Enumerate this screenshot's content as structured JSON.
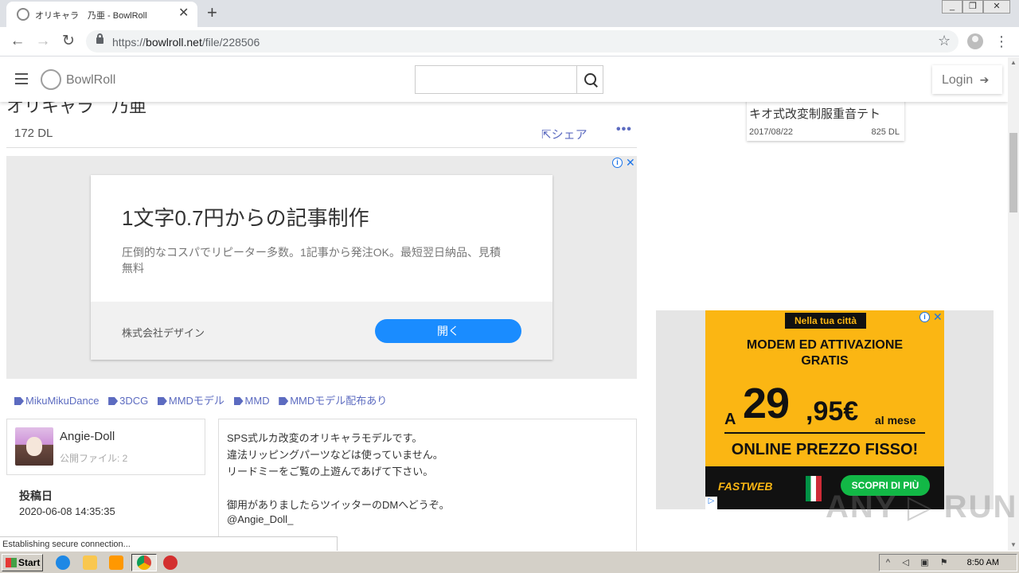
{
  "browser": {
    "tab_title": "オリキャラ　乃亜 - BowlRoll",
    "tab_close": "✕",
    "new_tab": "+",
    "url_scheme": "https://",
    "url_host": "bowlroll.net",
    "url_path": "/file/228506",
    "window_buttons": [
      "_",
      "❐",
      "✕"
    ]
  },
  "site": {
    "logo_text": "BowlRoll",
    "search": {
      "value": "",
      "placeholder": ""
    },
    "login_label": "Login"
  },
  "file": {
    "title_clipped": "オリキャラ　乃亜",
    "downloads": "172 DL",
    "share_label": "シェア",
    "more_label": "•••",
    "tags": [
      {
        "label": "MikuMikuDance"
      },
      {
        "label": "3DCG"
      },
      {
        "label": "MMDモデル"
      },
      {
        "label": "MMD"
      },
      {
        "label": "MMDモデル配布あり"
      }
    ],
    "author": {
      "name": "Angie-Doll",
      "files": "公開ファイル: 2"
    },
    "post_label": "投稿日",
    "post_date": "2020-06-08 14:35:35",
    "description": [
      "SPS式ルカ改変のオリキャラモデルです。",
      "違法リッピングパーツなどは使っていません。",
      "リードミーをご覧の上遊んであげて下さい。",
      "",
      "御用がありましたらツイッターのDMへどうぞ。",
      "@Angie_Doll_"
    ]
  },
  "ad1": {
    "headline": "1文字0.7円からの記事制作",
    "description": "圧倒的なコスパでリピーター多数。1記事から発注OK。最短翌日納品、見積無料",
    "advertiser": "株式会社デザイン",
    "cta": "開く",
    "info": "i",
    "close": "✕"
  },
  "related": {
    "title": "キオ式改変制服重音テト",
    "date": "2017/08/22",
    "downloads": "825 DL"
  },
  "ad2": {
    "tag": "Nella tua città",
    "headline_1": "MODEM ED ATTIVAZIONE",
    "headline_2": "GRATIS",
    "price_prefix": "A",
    "price_main": "29",
    "price_decimal": ",95€",
    "price_unit": "al mese",
    "subline": "ONLINE PREZZO FISSO!",
    "brand": "FASTWEB",
    "cta": "SCOPRI DI PIÙ",
    "info": "i",
    "close": "✕"
  },
  "status_text": "Establishing secure connection...",
  "watermark": "ANY ▷ RUN",
  "taskbar": {
    "start_label": "Start",
    "clock": "8:50 AM"
  },
  "colors": {
    "accent": "#5c6bc0",
    "ad_button": "#1a8cff",
    "ad2_yellow": "#fbb613",
    "ad2_green": "#12b846"
  }
}
